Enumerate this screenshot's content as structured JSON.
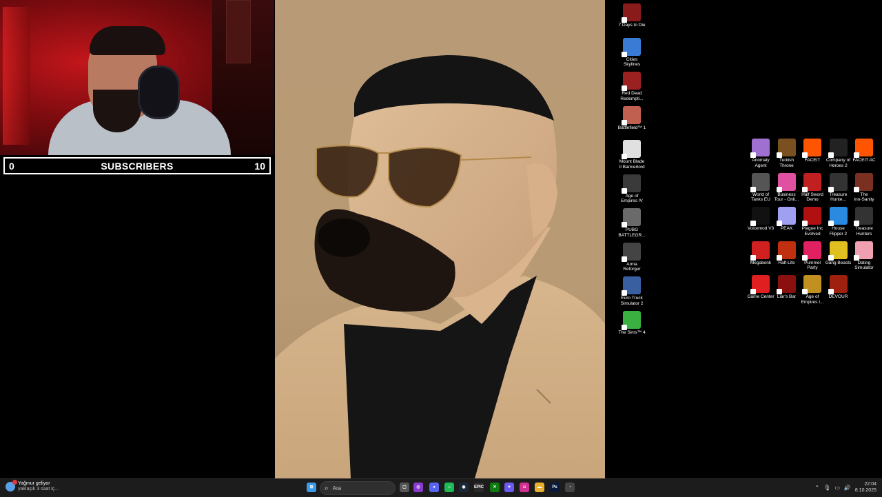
{
  "overlay": {
    "subscribers_current": "0",
    "subscribers_label": "SUBSCRIBERS",
    "subscribers_goal": "10"
  },
  "desktop": {
    "left_column": [
      {
        "label": "7 Days to Die",
        "icon": "7dtd-icon",
        "color": "#8a1b1b"
      },
      {
        "label": "Cities\nSkylines",
        "icon": "cities-skylines-icon",
        "color": "#3a7bd5"
      },
      {
        "label": "Red Dead\nRedempti...",
        "icon": "red-dead-icon",
        "color": "#9b2020"
      },
      {
        "label": "Battlefield™ 1",
        "icon": "battlefield-icon",
        "color": "#c06050"
      },
      {
        "label": "Mount  Blade\nII Bannerlord",
        "icon": "bannerlord-icon",
        "color": "#e0e0e0"
      },
      {
        "label": "Age of\nEmpires IV",
        "icon": "aoe4-icon",
        "color": "#3a3a3a"
      },
      {
        "label": "PUBG\nBATTLEGR...",
        "icon": "pubg-icon",
        "color": "#6a6a6a"
      },
      {
        "label": "Arma\nReforger",
        "icon": "arma-icon",
        "color": "#444"
      },
      {
        "label": "Euro Truck\nSimulator 2",
        "icon": "ets2-icon",
        "color": "#3a5fa0"
      },
      {
        "label": "The Sims™ 4",
        "icon": "sims4-icon",
        "color": "#3ab040"
      }
    ],
    "grid": [
      {
        "label": "Anomaly\nAgent",
        "icon": "anomaly-agent-icon",
        "color": "#a070d0"
      },
      {
        "label": "Turkish\nThrone",
        "icon": "turkish-throne-icon",
        "color": "#7a5020"
      },
      {
        "label": "FACEIT",
        "icon": "faceit-icon",
        "color": "#ff5500"
      },
      {
        "label": "Company of\nHeroes 2",
        "icon": "coh2-icon",
        "color": "#222"
      },
      {
        "label": "FACEIT AC",
        "icon": "faceit-ac-icon",
        "color": "#ff5500"
      },
      {
        "label": "World of\nTanks EU",
        "icon": "wot-icon",
        "color": "#555"
      },
      {
        "label": "Business\nTour - Onli...",
        "icon": "business-tour-icon",
        "color": "#e050a0"
      },
      {
        "label": "Half Sword\nDemo",
        "icon": "half-sword-icon",
        "color": "#c02020"
      },
      {
        "label": "Treasure\nHunte...",
        "icon": "treasure-hunter-icon",
        "color": "#333"
      },
      {
        "label": "The\nInn-Sanity",
        "icon": "inn-sanity-icon",
        "color": "#7a3020"
      },
      {
        "label": "Voicemod V3",
        "icon": "voicemod-icon",
        "color": "#111"
      },
      {
        "label": "PEAK",
        "icon": "peak-icon",
        "color": "#a0a0f0"
      },
      {
        "label": "Plague Inc\nEvolved",
        "icon": "plague-inc-icon",
        "color": "#b01010"
      },
      {
        "label": "House\nFlipper 2",
        "icon": "house-flipper-icon",
        "color": "#2a8ae0"
      },
      {
        "label": "Treasure\nHunters",
        "icon": "treasure-hunters-icon",
        "color": "#333"
      },
      {
        "label": "Megabonk",
        "icon": "megabonk-icon",
        "color": "#d02020"
      },
      {
        "label": "Half-Life",
        "icon": "half-life-icon",
        "color": "#c03010"
      },
      {
        "label": "Pummel\nParty",
        "icon": "pummel-party-icon",
        "color": "#e02060"
      },
      {
        "label": "Gang Beasts",
        "icon": "gang-beasts-icon",
        "color": "#e0c020"
      },
      {
        "label": "Dating\nSimulator",
        "icon": "dating-sim-icon",
        "color": "#f0a0b0"
      },
      {
        "label": "Game Center",
        "icon": "game-center-icon",
        "color": "#e02020"
      },
      {
        "label": "Liar's Bar",
        "icon": "liars-bar-icon",
        "color": "#8a1010"
      },
      {
        "label": "Age of\nEmpires I...",
        "icon": "aoe-icon",
        "color": "#c09020"
      },
      {
        "label": "DEVOUR",
        "icon": "devour-icon",
        "color": "#a02010"
      }
    ]
  },
  "taskbar": {
    "notification_title": "Yağmur geliyor",
    "notification_sub": "yaklaşık 3 saat iç...",
    "search_placeholder": "Ara",
    "time": "22:04",
    "date": "8.10.2025",
    "apps": [
      {
        "name": "windows-start-icon",
        "color": "#3a9ae8",
        "glyph": "⊞"
      },
      {
        "name": "task-view-icon",
        "color": "#555",
        "glyph": "▢"
      },
      {
        "name": "twitch-icon",
        "color": "#8a3ad0",
        "glyph": "◎"
      },
      {
        "name": "discord-icon",
        "color": "#5865f2",
        "glyph": "●"
      },
      {
        "name": "spotify-icon",
        "color": "#1db954",
        "glyph": "♫"
      },
      {
        "name": "steam-icon",
        "color": "#1b2838",
        "glyph": "◉"
      },
      {
        "name": "epic-games-icon",
        "color": "#2a2a2a",
        "glyph": "EPIC"
      },
      {
        "name": "xbox-icon",
        "color": "#107c10",
        "glyph": "✕"
      },
      {
        "name": "copilot-icon",
        "color": "#6a5af0",
        "glyph": "✦"
      },
      {
        "name": "instagram-icon",
        "color": "#d03090",
        "glyph": "◘"
      },
      {
        "name": "file-explorer-icon",
        "color": "#e8b030",
        "glyph": "▬"
      },
      {
        "name": "photoshop-icon",
        "color": "#0a1a3a",
        "glyph": "Ps"
      },
      {
        "name": "chrome-icon",
        "color": "#444",
        "glyph": "◔"
      }
    ]
  }
}
